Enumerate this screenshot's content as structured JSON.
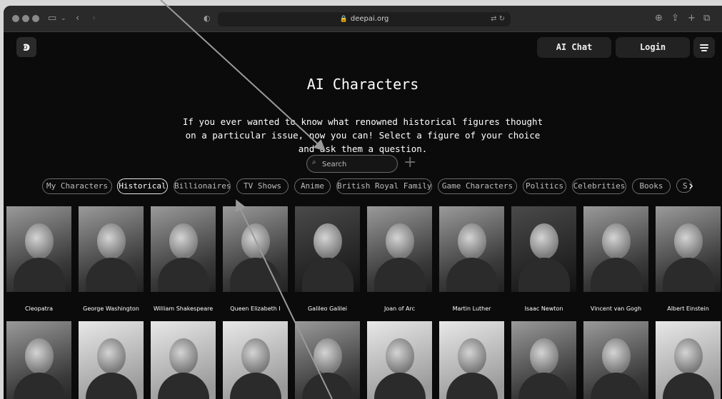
{
  "browser": {
    "url": "deepai.org"
  },
  "header": {
    "logo": "ͽ",
    "ai_chat_label": "AI Chat",
    "login_label": "Login"
  },
  "hero": {
    "title": "AI Characters",
    "description": "If you ever wanted to know what renowned historical figures thought on a particular issue, now you can! Select a figure of your choice and ask them a question."
  },
  "search": {
    "placeholder": "Search",
    "value": ""
  },
  "categories": [
    "My Characters",
    "Historical",
    "Billionaires",
    "TV Shows",
    "Anime",
    "British Royal Family",
    "Game Characters",
    "Politics",
    "Celebrities",
    "Books",
    "S"
  ],
  "active_category": "Historical",
  "characters_row1": [
    "Cleopatra",
    "George Washington",
    "William Shakespeare",
    "Queen Elizabeth I",
    "Galileo Galilei",
    "Joan of Arc",
    "Martin Luther",
    "Isaac Newton",
    "Vincent van Gogh",
    "Albert Einstein"
  ],
  "characters_row2": [
    "",
    "",
    "",
    "",
    "",
    "",
    "",
    "",
    "",
    ""
  ]
}
